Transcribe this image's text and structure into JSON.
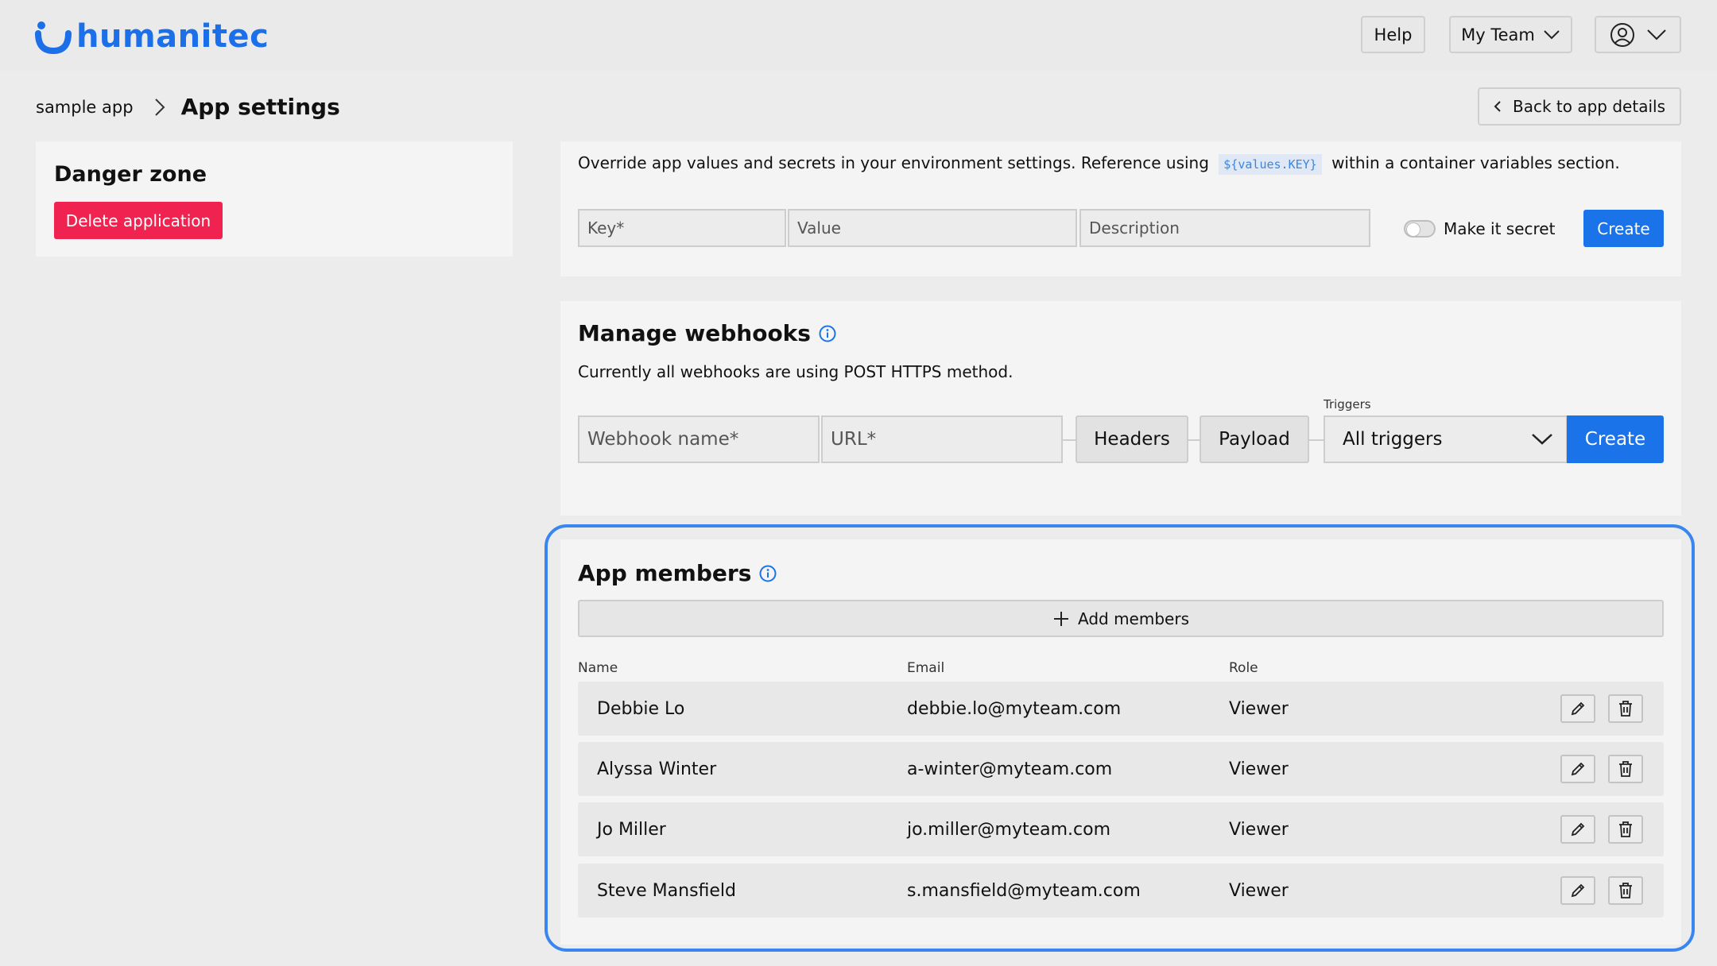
{
  "header": {
    "brand": "humanitec",
    "help_label": "Help",
    "team_label": "My Team"
  },
  "breadcrumb": {
    "app": "sample app",
    "title": "App settings"
  },
  "back_label": "Back to app details",
  "danger": {
    "title": "Danger zone",
    "delete_label": "Delete application"
  },
  "values": {
    "description_before": "Override app values and secrets in your environment settings. Reference using",
    "code": "${values.KEY}",
    "description_after": "within a container variables section.",
    "key_placeholder": "Key*",
    "value_placeholder": "Value",
    "description_placeholder": "Description",
    "secret_label": "Make it secret",
    "create_label": "Create"
  },
  "webhooks": {
    "title": "Manage webhooks",
    "subtitle": "Currently all webhooks are using POST HTTPS method.",
    "name_placeholder": "Webhook name*",
    "url_placeholder": "URL*",
    "headers_label": "Headers",
    "payload_label": "Payload",
    "triggers_label": "Triggers",
    "triggers_value": "All triggers",
    "create_label": "Create"
  },
  "members": {
    "title": "App members",
    "add_label": "Add members",
    "columns": {
      "name": "Name",
      "email": "Email",
      "role": "Role"
    },
    "rows": [
      {
        "name": "Debbie Lo",
        "email": "debbie.lo@myteam.com",
        "role": "Viewer"
      },
      {
        "name": "Alyssa Winter",
        "email": "a-winter@myteam.com",
        "role": "Viewer"
      },
      {
        "name": "Jo Miller",
        "email": "jo.miller@myteam.com",
        "role": "Viewer"
      },
      {
        "name": "Steve Mansfield",
        "email": "s.mansfield@myteam.com",
        "role": "Viewer"
      }
    ]
  }
}
